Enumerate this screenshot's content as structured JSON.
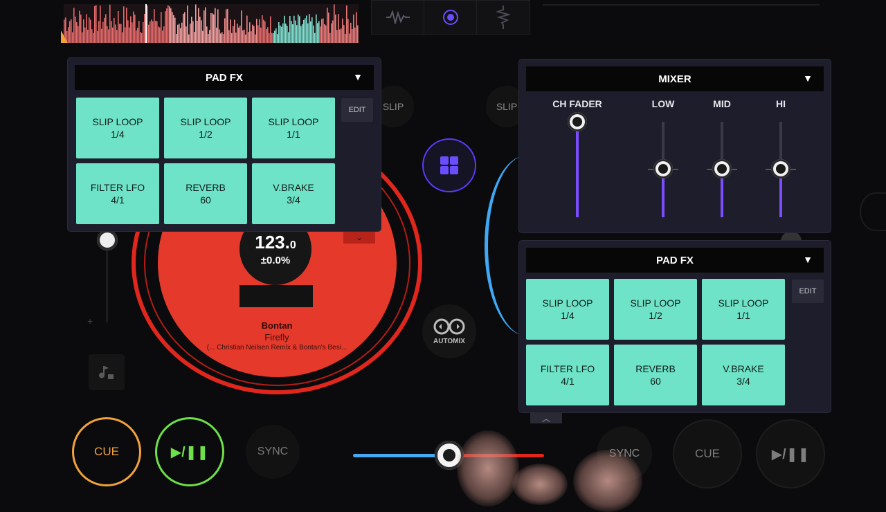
{
  "deckA": {
    "bpm": "123.",
    "bpm_decimal": "0",
    "pitch": "±0.0%",
    "artist": "Bontan",
    "title": "Firefly",
    "remix": "(... Christian Neilsen Remix & Bontan's Besi...",
    "cue_label": "CUE",
    "play_label": "▶/❚❚",
    "sync_label": "SYNC",
    "slip_label": "SLIP",
    "color": "#e5392c"
  },
  "deckB": {
    "cue_label": "CUE",
    "play_label": "▶/❚❚",
    "sync_label": "SYNC",
    "slip_label": "SLIP",
    "color": "#3fa9f5"
  },
  "padfx_left": {
    "header": "PAD FX",
    "arrow": "▼",
    "edit_label": "EDIT",
    "pads": [
      {
        "name": "SLIP LOOP",
        "value": "1/4"
      },
      {
        "name": "SLIP LOOP",
        "value": "1/2"
      },
      {
        "name": "SLIP LOOP",
        "value": "1/1"
      },
      {
        "name": "FILTER LFO",
        "value": "4/1"
      },
      {
        "name": "REVERB",
        "value": "60"
      },
      {
        "name": "V.BRAKE",
        "value": "3/4"
      }
    ]
  },
  "padfx_right": {
    "header": "PAD FX",
    "arrow": "▼",
    "edit_label": "EDIT",
    "pads": [
      {
        "name": "SLIP LOOP",
        "value": "1/4"
      },
      {
        "name": "SLIP LOOP",
        "value": "1/2"
      },
      {
        "name": "SLIP LOOP",
        "value": "1/1"
      },
      {
        "name": "FILTER LFO",
        "value": "4/1"
      },
      {
        "name": "REVERB",
        "value": "60"
      },
      {
        "name": "V.BRAKE",
        "value": "3/4"
      }
    ]
  },
  "mixer": {
    "header": "MIXER",
    "arrow": "▼",
    "ch_fader_label": "CH FADER",
    "low_label": "LOW",
    "mid_label": "MID",
    "hi_label": "HI"
  },
  "center": {
    "automix_label": "AUTOMIX"
  },
  "colors": {
    "pad": "#6fe3c8",
    "accent": "#7b4dff",
    "cue": "#f2a23a",
    "play": "#6ee04a"
  },
  "icons": [
    "waveform-icon",
    "target-icon",
    "zigzag-icon",
    "grid-icon",
    "automix-icon",
    "note-lock-icon",
    "chevron-up-icon",
    "chevron-down-icon"
  ]
}
